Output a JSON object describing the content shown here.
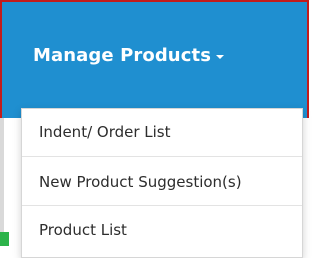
{
  "nav": {
    "menu_title": "Manage Products",
    "menu_title_icon": "caret-down-icon"
  },
  "dropdown": {
    "items": [
      {
        "label": "Indent/ Order List"
      },
      {
        "label": "New Product Suggestion(s)"
      },
      {
        "label": "Product List"
      }
    ]
  },
  "colors": {
    "navbar_bg": "#1f8fd0",
    "navbar_border": "#c31b1b",
    "menu_text": "#2d2d2d",
    "accent_green": "#2cb34a"
  }
}
